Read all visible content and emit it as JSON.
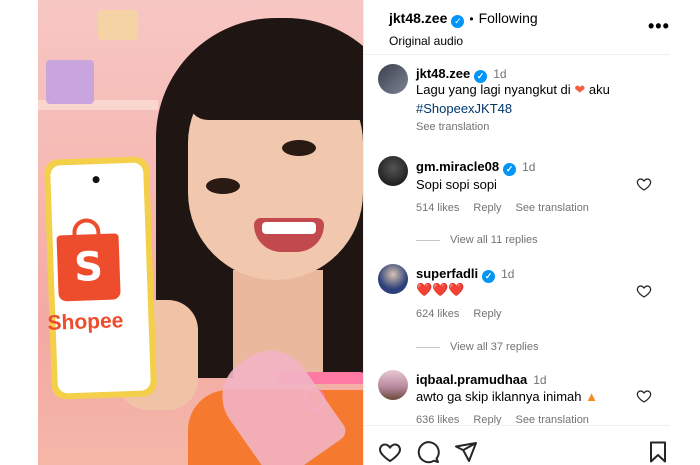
{
  "post": {
    "username": "jkt48.zee",
    "follow_status": "Following",
    "audio_label": "Original audio",
    "more_icon": "more-horizontal-icon"
  },
  "media": {
    "phone_brand_word": "Shopee",
    "phone_brand_letter": "S"
  },
  "caption": {
    "username": "jkt48.zee",
    "time": "1d",
    "text_before_heart": "Lagu yang lagi nyangkut di",
    "text_after_heart": "aku",
    "hashtag": "#ShopeexJKT48",
    "see_translation": "See translation"
  },
  "comments": [
    {
      "username": "gm.miracle08",
      "verified": true,
      "time": "1d",
      "text": "Sopi sopi sopi",
      "likes": "514 likes",
      "reply": "Reply",
      "see_translation": "See translation",
      "view_replies": "View all 11 replies"
    },
    {
      "username": "superfadli",
      "verified": true,
      "time": "1d",
      "text": "❤️❤️❤️",
      "likes": "624 likes",
      "reply": "Reply",
      "view_replies": "View all 37 replies"
    },
    {
      "username": "iqbaal.pramudhaa",
      "verified": false,
      "time": "1d",
      "text": "awto ga skip iklannya inimah",
      "likes": "636 likes",
      "reply": "Reply",
      "see_translation": "See translation"
    }
  ],
  "actions": [
    "like-icon",
    "comment-icon",
    "share-icon",
    "save-icon"
  ],
  "colors": {
    "verified_blue": "#0095f6",
    "hashtag": "#00376b",
    "shopee_orange": "#ee4d2d",
    "heart_red": "#ed4956",
    "meta_gray": "#737373"
  }
}
